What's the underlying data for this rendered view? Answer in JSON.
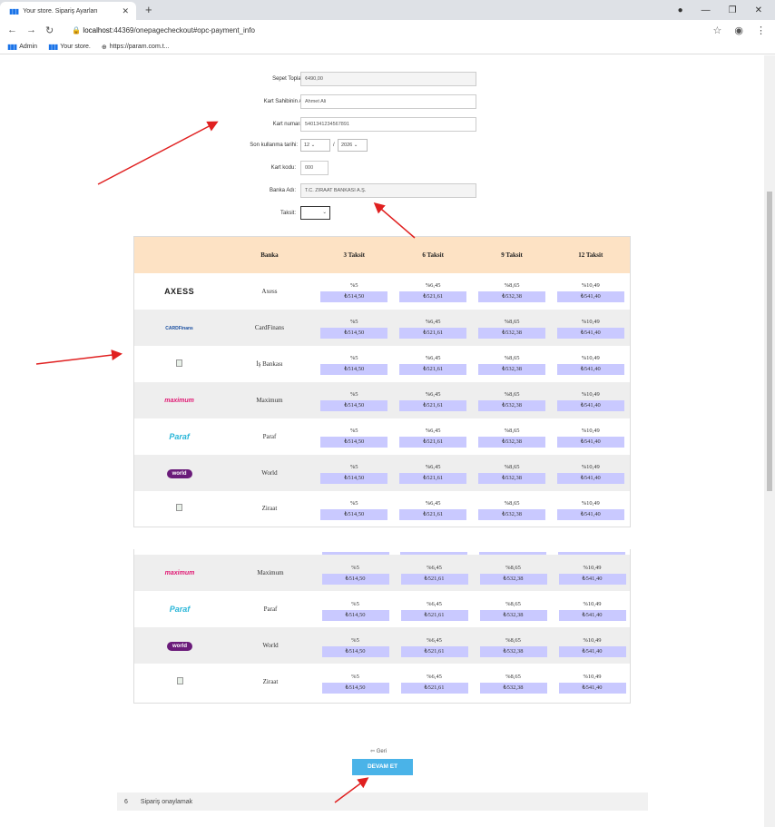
{
  "browser": {
    "tab_title": "Your store. Sipariş Ayarları",
    "tab_close": "✕",
    "new_tab": "+",
    "url_host": "localhost",
    "url_rest": ":44369/onepagecheckout#opc-payment_info",
    "bookmarks": [
      "Admin",
      "Your store.",
      "https://param.com.t..."
    ]
  },
  "form": {
    "sepet_label": "Sepet Toplamı:",
    "sepet_value": "¢490,00",
    "name_label": "Kart Sahibinin Adı:",
    "name_value": "Ahmet Ali",
    "number_label": "Kart numarası:",
    "number_value": "5401341234567891",
    "expiry_label": "Son kullanma tarihi:",
    "expiry_month": "12",
    "expiry_sep": "/",
    "expiry_year": "2026",
    "cvv_label": "Kart kodu:",
    "cvv_value": "000",
    "bank_label": "Banka Adı:",
    "bank_value": "T.C. ZIRAAT BANKASI A.Ş.",
    "taksit_label": "Taksit:",
    "taksit_value": ""
  },
  "table": {
    "headers": [
      "",
      "Banka",
      "3 Taksit",
      "6 Taksit",
      "9 Taksit",
      "12 Taksit"
    ],
    "rates": [
      "%5",
      "%6,45",
      "%8,65",
      "%10,49"
    ],
    "amounts": [
      "₺514,50",
      "₺521,61",
      "₺532,38",
      "₺541,40"
    ],
    "banks": [
      {
        "name": "Axess",
        "logo": "AXESS"
      },
      {
        "name": "CardFinans",
        "logo": "CARDFinans"
      },
      {
        "name": "İş Bankası",
        "logo": ""
      },
      {
        "name": "Maximum",
        "logo": "maximum"
      },
      {
        "name": "Paraf",
        "logo": "Paraf"
      },
      {
        "name": "World",
        "logo": "world"
      },
      {
        "name": "Ziraat",
        "logo": ""
      }
    ],
    "second_banks": [
      {
        "name": "Maximum",
        "logo": "maximum"
      },
      {
        "name": "Paraf",
        "logo": "Paraf"
      },
      {
        "name": "World",
        "logo": "world"
      },
      {
        "name": "Ziraat",
        "logo": ""
      }
    ]
  },
  "actions": {
    "back": "Geri",
    "continue": "DEVAM ET"
  },
  "step": {
    "number": "6",
    "label": "Sipariş onaylamak"
  },
  "colors": {
    "header_bg": "#fde2c4",
    "amount_bg": "#c9c9ff",
    "button_bg": "#4ab3e8",
    "arrow": "#e02020"
  }
}
